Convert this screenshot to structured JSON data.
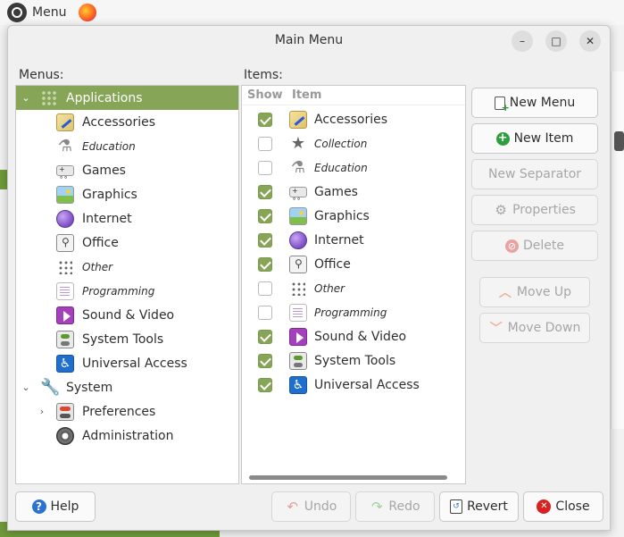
{
  "topbar": {
    "menu_label": "Menu"
  },
  "dialog": {
    "title": "Main Menu",
    "minimize_symbol": "–",
    "maximize_symbol": "□",
    "close_symbol": "✕"
  },
  "menus_label": "Menus:",
  "items_label": "Items:",
  "menus_tree": [
    {
      "label": "Applications",
      "icon": "applications-grid-icon",
      "expander": "⌄",
      "selected": true,
      "italic": false
    },
    {
      "label": "Accessories",
      "icon": "accessories-icon",
      "italic": false
    },
    {
      "label": "Education",
      "icon": "education-flask-icon",
      "italic": true
    },
    {
      "label": "Games",
      "icon": "games-controller-icon",
      "italic": false
    },
    {
      "label": "Graphics",
      "icon": "graphics-image-icon",
      "italic": false
    },
    {
      "label": "Internet",
      "icon": "internet-globe-icon",
      "italic": false
    },
    {
      "label": "Office",
      "icon": "office-document-icon",
      "italic": false
    },
    {
      "label": "Other",
      "icon": "other-dots-icon",
      "italic": true
    },
    {
      "label": "Programming",
      "icon": "programming-document-icon",
      "italic": true
    },
    {
      "label": "Sound & Video",
      "icon": "sound-video-play-icon",
      "italic": false
    },
    {
      "label": "System Tools",
      "icon": "system-tools-toggle-icon",
      "italic": false
    },
    {
      "label": "Universal Access",
      "icon": "universal-access-person-icon",
      "italic": false
    },
    {
      "label": "System",
      "icon": "system-wrench-icon",
      "expander": "⌄",
      "italic": false
    },
    {
      "label": "Preferences",
      "icon": "preferences-toggle-icon",
      "expander": "›",
      "italic": false
    },
    {
      "label": "Administration",
      "icon": "administration-gear-icon",
      "italic": false
    }
  ],
  "items_columns": {
    "show": "Show",
    "item": "Item"
  },
  "items": [
    {
      "label": "Accessories",
      "checked": true,
      "italic": false,
      "icon": "accessories-icon"
    },
    {
      "label": "Collection",
      "checked": false,
      "italic": true,
      "icon": "collection-star-icon"
    },
    {
      "label": "Education",
      "checked": false,
      "italic": true,
      "icon": "education-flask-icon"
    },
    {
      "label": "Games",
      "checked": true,
      "italic": false,
      "icon": "games-controller-icon"
    },
    {
      "label": "Graphics",
      "checked": true,
      "italic": false,
      "icon": "graphics-image-icon"
    },
    {
      "label": "Internet",
      "checked": true,
      "italic": false,
      "icon": "internet-globe-icon"
    },
    {
      "label": "Office",
      "checked": true,
      "italic": false,
      "icon": "office-document-icon"
    },
    {
      "label": "Other",
      "checked": false,
      "italic": true,
      "icon": "other-dots-icon"
    },
    {
      "label": "Programming",
      "checked": false,
      "italic": true,
      "icon": "programming-document-icon"
    },
    {
      "label": "Sound & Video",
      "checked": true,
      "italic": false,
      "icon": "sound-video-play-icon"
    },
    {
      "label": "System Tools",
      "checked": true,
      "italic": false,
      "icon": "system-tools-toggle-icon"
    },
    {
      "label": "Universal Access",
      "checked": true,
      "italic": false,
      "icon": "universal-access-person-icon"
    }
  ],
  "side_buttons": {
    "new_menu": "New Menu",
    "new_item": "New Item",
    "new_separator": "New Separator",
    "properties": "Properties",
    "delete": "Delete",
    "move_up": "Move Up",
    "move_down": "Move Down"
  },
  "bottom_buttons": {
    "help": "Help",
    "undo": "Undo",
    "redo": "Redo",
    "revert": "Revert",
    "close": "Close"
  },
  "colors": {
    "selection": "#87a556",
    "checkbox_on": "#87a556"
  }
}
